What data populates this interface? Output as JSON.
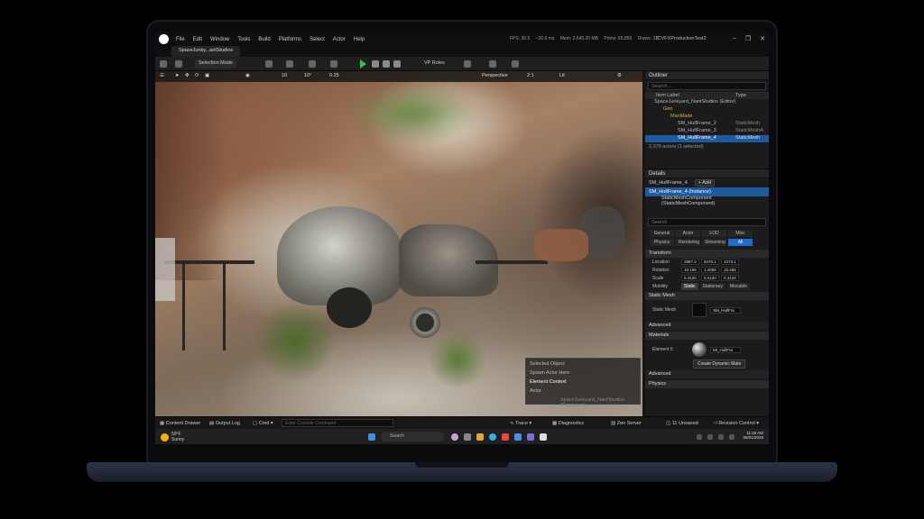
{
  "menu": [
    "File",
    "Edit",
    "Window",
    "Tools",
    "Build",
    "Platforms",
    "Select",
    "Actor",
    "Help"
  ],
  "stats": {
    "fps": "FPS: 30.5",
    "ms": "−20.6 ms",
    "mem": "Mem: 2,645.20 MB",
    "prims": "Prims: 65,855",
    "draws": "Draws: 22"
  },
  "project_name": "ICVFXProductionTest2",
  "window_controls": [
    "–",
    "❐",
    "✕"
  ],
  "doc_tab": "SpaceJunky...antStudios",
  "toolbar": {
    "selection_mode": "Selection Mode",
    "vp_roles": "VP Roles"
  },
  "viewport": {
    "perspective": "Perspective",
    "lit": "Lit",
    "snap_values": [
      "10",
      "10°",
      "0.25"
    ],
    "scale": "2:1",
    "context_menu": [
      "Selected Object",
      "Spawn Actor Here",
      "Element Context",
      "Actor"
    ],
    "context_footer": "SpaceJunkyard_NantStudios (Persistent)"
  },
  "outliner": {
    "title": "Outliner",
    "search_placeholder": "Search...",
    "col_label": "Item Label",
    "col_type": "Type",
    "rows": [
      {
        "label": "SpaceJunkyard_NantStudios (Editor)",
        "type": ""
      },
      {
        "label": "Geo",
        "type": ""
      },
      {
        "label": "ManMade",
        "type": ""
      },
      {
        "label": "SM_HullFrame_2",
        "type": "StaticMesh"
      },
      {
        "label": "SM_HullFrame_3",
        "type": "StaticMeshA"
      },
      {
        "label": "SM_HullFrame_4",
        "type": "StaticMesh"
      }
    ],
    "footer": "2,375 actors (1 selected)"
  },
  "details": {
    "title": "Details",
    "object_name": "SM_HullFrame_4",
    "add_label": "Add",
    "instance": "SM_HullFrame_4 (Instance)",
    "component": "StaticMeshComponent (StaticMeshComponent)",
    "search_placeholder": "Search",
    "filters": [
      "General",
      "Actor",
      "LOD",
      "Misc",
      "Physics",
      "Rendering",
      "Streaming",
      "All"
    ],
    "transform_title": "Transform",
    "location": {
      "label": "Location",
      "x": "2867.2",
      "y": "8476.1",
      "z": "1073.1"
    },
    "rotation": {
      "label": "Rotation",
      "x": "10.156",
      "y": "1.4056",
      "z": "15.466"
    },
    "scale": {
      "label": "Scale",
      "x": "0.4120",
      "y": "0.4120",
      "z": "0.4120"
    },
    "mobility": {
      "label": "Mobility",
      "options": [
        "Static",
        "Stationary",
        "Movable"
      ]
    },
    "static_mesh_title": "Static Mesh",
    "static_mesh_label": "Static Mesh",
    "static_mesh_value": "SM_HullFra",
    "advanced": "Advanced",
    "materials_title": "Materials",
    "element_label": "Element 0",
    "material_value": "MI_HullFra",
    "create_dynamic": "Create Dynamic Mate",
    "advanced2": "Advanced",
    "physics_title": "Physics"
  },
  "statusbar": {
    "content_drawer": "Content Drawer",
    "output_log": "Output Log",
    "cmd": "Cmd",
    "console_placeholder": "Enter Console Command",
    "trace": "Trace",
    "diagnostics": "Diagnostics",
    "zen": "Zen Server",
    "unsaved": "11 Unsaved",
    "revision": "Revision Control"
  },
  "taskbar": {
    "temp": "59°F",
    "condition": "Sunny",
    "search": "Search",
    "time": "11:26 AM",
    "date": "06/01/2025"
  },
  "colors": {
    "selection": "#1f5a9e",
    "accent": "#1b6ed6",
    "play": "#3fbf3f"
  }
}
